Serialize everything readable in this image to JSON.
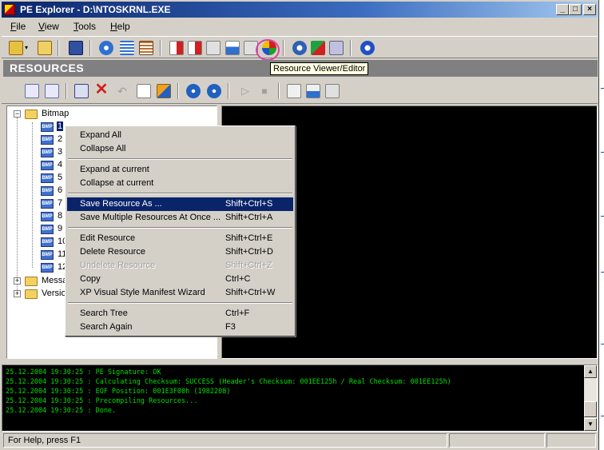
{
  "window": {
    "title": "PE Explorer - D:\\NTOSKRNL.EXE",
    "controls": {
      "minimize": "_",
      "maximize": "□",
      "close": "×"
    }
  },
  "menu": [
    {
      "label": "File",
      "key": "F",
      "rest": "ile"
    },
    {
      "label": "View",
      "key": "V",
      "rest": "iew"
    },
    {
      "label": "Tools",
      "key": "T",
      "rest": "ools"
    },
    {
      "label": "Help",
      "key": "H",
      "rest": "elp"
    }
  ],
  "tooltip": "Resource Viewer/Editor",
  "section_header": "RESOURCES",
  "tree": {
    "root": "Bitmap",
    "bitmap_items": [
      "1",
      "2",
      "3",
      "4",
      "5",
      "6",
      "7",
      "8",
      "9",
      "10",
      "11",
      "12"
    ],
    "icon_text": "BMP",
    "other_nodes": [
      "Messa",
      "Versio"
    ]
  },
  "context_menu": {
    "items": [
      {
        "label": "Expand All",
        "shortcut": ""
      },
      {
        "label": "Collapse All",
        "shortcut": ""
      },
      {
        "label": "Expand at current",
        "shortcut": ""
      },
      {
        "label": "Collapse at current",
        "shortcut": ""
      },
      {
        "label": "Save Resource As ...",
        "shortcut": "Shift+Ctrl+S"
      },
      {
        "label": "Save Multiple Resources At Once ...",
        "shortcut": "Shift+Ctrl+A"
      },
      {
        "label": "Edit Resource",
        "shortcut": "Shift+Ctrl+E"
      },
      {
        "label": "Delete Resource",
        "shortcut": "Shift+Ctrl+D"
      },
      {
        "label": "Undelete Resource",
        "shortcut": "Shift+Ctrl+Z"
      },
      {
        "label": "Copy",
        "shortcut": "Ctrl+C"
      },
      {
        "label": "XP Visual Style Manifest Wizard",
        "shortcut": "Shift+Ctrl+W"
      },
      {
        "label": "Search Tree",
        "shortcut": "Ctrl+F"
      },
      {
        "label": "Search Again",
        "shortcut": "F3"
      }
    ]
  },
  "log": [
    "25.12.2004 19:30:25 : PE Signature: OK",
    "25.12.2004 19:30:25 : Calculating Checksum: SUCCESS (Header's Checksum: 001EE125h / Real Checksum: 001EE125h)",
    "25.12.2004 19:30:25 : EOF Position: 001E3F00h  (1982208)",
    "25.12.2004 19:30:25 : Precompiling Resources...",
    "25.12.2004 19:30:25 : Done."
  ],
  "status": {
    "help": "For Help, press F1"
  },
  "colors": {
    "title_start": "#0a246a",
    "title_end": "#a6caf0",
    "highlight_ring": "#e040a0",
    "log_text": "#00e000",
    "selection": "#0a246a"
  }
}
